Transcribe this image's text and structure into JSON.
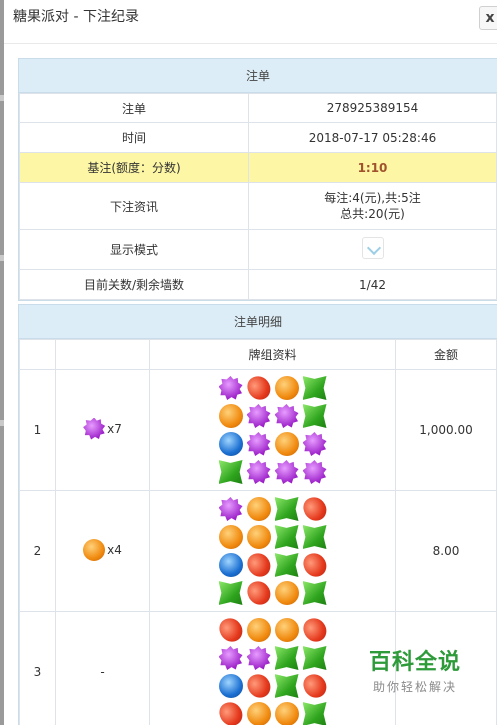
{
  "window": {
    "title": "糖果派对 - 下注纪录",
    "close_glyph": "x"
  },
  "order_panel": {
    "heading": "注单",
    "rows": [
      {
        "label": "注单",
        "value": "278925389154"
      },
      {
        "label": "时间",
        "value": "2018-07-17 05:28:46"
      },
      {
        "label": "基注(额度：分数)",
        "value": "1:10",
        "highlight": true
      },
      {
        "label": "下注资讯",
        "value_line1": "每注:4(元),共:5注",
        "value_line2": "总共:20(元)"
      },
      {
        "label": "显示模式",
        "value_icon": "view-mode-icon"
      },
      {
        "label": "目前关数/剩余墙数",
        "value": "1/42"
      }
    ]
  },
  "detail_panel": {
    "heading": "注单明细",
    "columns": [
      "",
      "",
      "牌组资料",
      "金额"
    ],
    "rows": [
      {
        "index": "1",
        "win_candy": "purple",
        "win_count": "x7",
        "amount": "1,000.00",
        "grid": [
          "purple",
          "red",
          "orange",
          "green",
          "orange",
          "purple",
          "purple",
          "green",
          "blue",
          "purple",
          "orange",
          "purple",
          "green",
          "purple",
          "purple",
          "purple"
        ]
      },
      {
        "index": "2",
        "win_candy": "orange",
        "win_count": "x4",
        "amount": "8.00",
        "grid": [
          "purple",
          "orange",
          "green",
          "red",
          "orange",
          "orange",
          "green",
          "green",
          "blue",
          "red",
          "green",
          "red",
          "green",
          "red",
          "orange",
          "green"
        ]
      },
      {
        "index": "3",
        "win_candy": "",
        "win_count": "-",
        "amount": "",
        "grid": [
          "red",
          "orange",
          "orange",
          "red",
          "purple",
          "purple",
          "green",
          "green",
          "blue",
          "red",
          "green",
          "red",
          "red",
          "orange",
          "orange",
          "green"
        ]
      }
    ]
  },
  "watermark": {
    "line1": "百科全说",
    "line2": "助你轻松解决"
  },
  "colors": {
    "panel_header": "#ddedf7",
    "highlight_row": "#fdf6a5",
    "watermark_green": "#2e9b3a"
  }
}
